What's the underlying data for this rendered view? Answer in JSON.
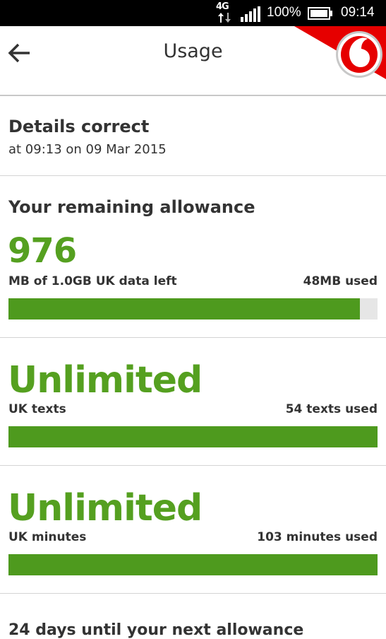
{
  "status_bar": {
    "network": "4G",
    "battery_percent": "100%",
    "time": "09:14"
  },
  "header": {
    "title": "Usage",
    "back_icon": "arrow-left-icon",
    "brand_icon": "vodafone-logo-icon"
  },
  "details": {
    "heading": "Details correct",
    "timestamp": "at 09:13 on 09 Mar 2015"
  },
  "allowance": {
    "heading": "Your remaining allowance",
    "items": [
      {
        "value": "976",
        "label": "MB of 1.0GB UK data left",
        "used": "48MB used",
        "fill_fraction": 0.953
      },
      {
        "value": "Unlimited",
        "label": "UK texts",
        "used": "54 texts used",
        "fill_fraction": 1.0
      },
      {
        "value": "Unlimited",
        "label": "UK minutes",
        "used": "103 minutes used",
        "fill_fraction": 1.0
      }
    ]
  },
  "next_allowance": "24 days until your next allowance",
  "colors": {
    "accent_green": "#4e9a1e",
    "brand_red": "#e60000",
    "track_grey": "#e6e6e6"
  }
}
